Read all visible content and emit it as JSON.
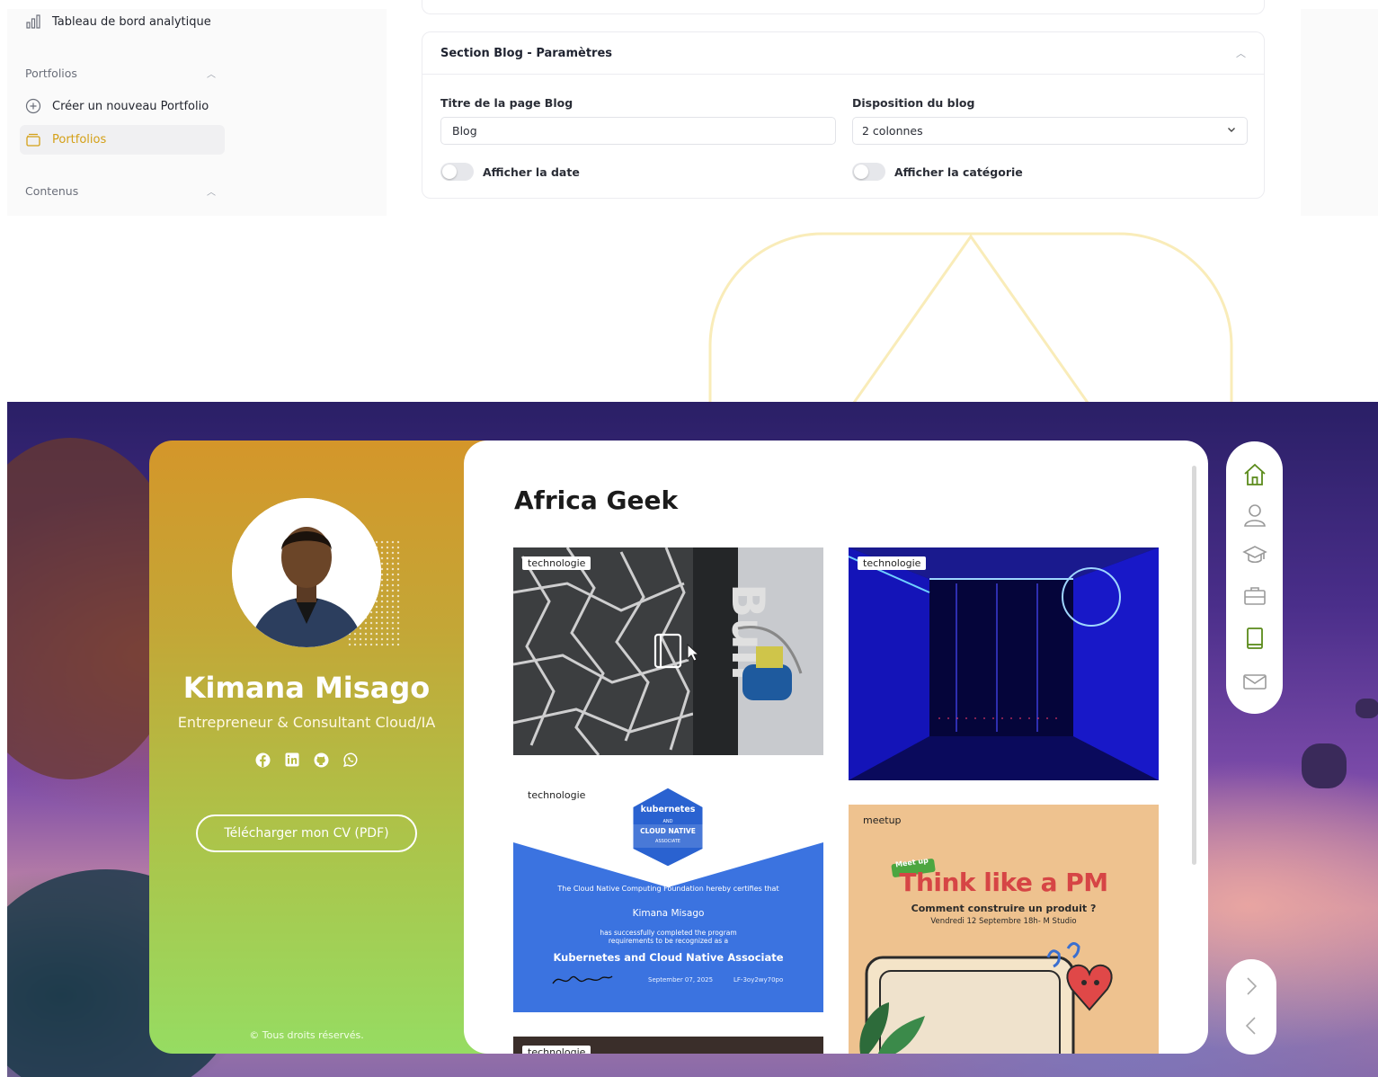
{
  "sidebar": {
    "analytics": "Tableau de bord analytique",
    "portfolios_header": "Portfolios",
    "create_portfolio": "Créer un nouveau Portfolio",
    "portfolios": "Portfolios",
    "contents_header": "Contenus"
  },
  "blog_settings": {
    "section_title": "Section Blog - Paramètres",
    "title_label": "Titre de la page Blog",
    "title_value": "Blog",
    "layout_label": "Disposition du blog",
    "layout_value": "2 colonnes",
    "show_date": "Afficher la date",
    "show_category": "Afficher la catégorie"
  },
  "profile": {
    "name": "Kimana Misago",
    "role": "Entrepreneur & Consultant Cloud/IA",
    "cv_button": "Télécharger mon CV (PDF)",
    "copyright": "© Tous droits réservés."
  },
  "blog": {
    "title": "Africa Geek",
    "posts": [
      {
        "tag": "technologie"
      },
      {
        "tag": "technologie"
      },
      {
        "tag": "technologie"
      },
      {
        "tag": "meetup"
      },
      {
        "tag": "technologie"
      }
    ]
  },
  "cert": {
    "badge_top": "kubernetes",
    "badge_and": "AND",
    "badge_mid": "CLOUD NATIVE",
    "badge_bottom": "ASSOCIATE",
    "intro": "The Cloud Native Computing Foundation hereby certifies that",
    "recipient": "Kimana Misago",
    "completed": "has successfully completed the program requirements to be recognized as a",
    "program": "Kubernetes and Cloud Native Associate",
    "date": "September 07, 2025",
    "cert_id": "LF-3oy2wy70po"
  },
  "meetup": {
    "badge": "Meet up",
    "headline": "Think like a PM",
    "question": "Comment construire un produit ?",
    "when": "Vendredi 12 Septembre 18h- M Studio"
  },
  "colors": {
    "accent": "#d4a017",
    "nav_active": "#5a8a1a",
    "nav_inactive": "#9a9a9a"
  }
}
